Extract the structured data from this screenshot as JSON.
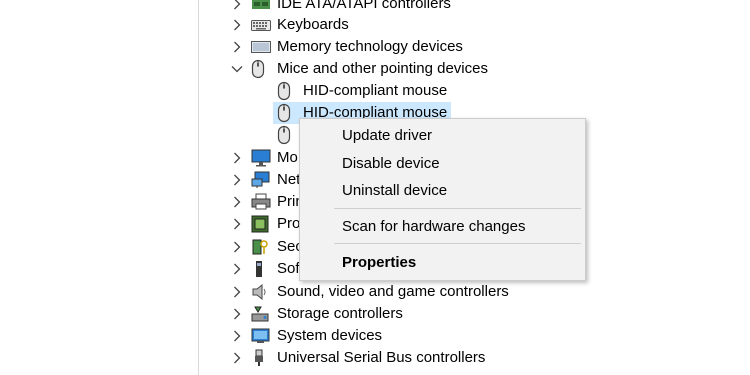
{
  "tree": {
    "items": [
      {
        "label": "IDE ATA/ATAPI controllers",
        "icon": "ide-controller-icon",
        "expanded": false
      },
      {
        "label": "Keyboards",
        "icon": "keyboard-icon",
        "expanded": false
      },
      {
        "label": "Memory technology devices",
        "icon": "memory-device-icon",
        "expanded": false
      },
      {
        "label": "Mice and other pointing devices",
        "icon": "mouse-icon",
        "expanded": true
      },
      {
        "label": "HID-compliant mouse",
        "icon": "mouse-icon"
      },
      {
        "label": "HID-compliant mouse",
        "icon": "mouse-icon",
        "selected": true
      },
      {
        "label": "",
        "icon": "mouse-icon"
      },
      {
        "label": "Mo",
        "icon": "monitor-icon",
        "expanded": false
      },
      {
        "label": "Net",
        "icon": "network-adapter-icon",
        "expanded": false
      },
      {
        "label": "Prin",
        "icon": "printer-icon",
        "expanded": false
      },
      {
        "label": "Pro",
        "icon": "processor-icon",
        "expanded": false
      },
      {
        "label": "Sec",
        "icon": "security-device-icon",
        "expanded": false
      },
      {
        "label": "Sof",
        "icon": "software-device-icon",
        "expanded": false
      },
      {
        "label": "Sound, video and game controllers",
        "icon": "speaker-icon",
        "expanded": false
      },
      {
        "label": "Storage controllers",
        "icon": "storage-controller-icon",
        "expanded": false
      },
      {
        "label": "System devices",
        "icon": "system-device-icon",
        "expanded": false
      },
      {
        "label": "Universal Serial Bus controllers",
        "icon": "usb-icon",
        "expanded": false
      }
    ]
  },
  "context_menu": {
    "update_driver": "Update driver",
    "disable_device": "Disable device",
    "uninstall_device": "Uninstall device",
    "scan_hardware": "Scan for hardware changes",
    "properties": "Properties"
  },
  "colors": {
    "selection": "#cce8ff",
    "menu_background": "#f2f2f2",
    "menu_border": "#cccccc"
  }
}
